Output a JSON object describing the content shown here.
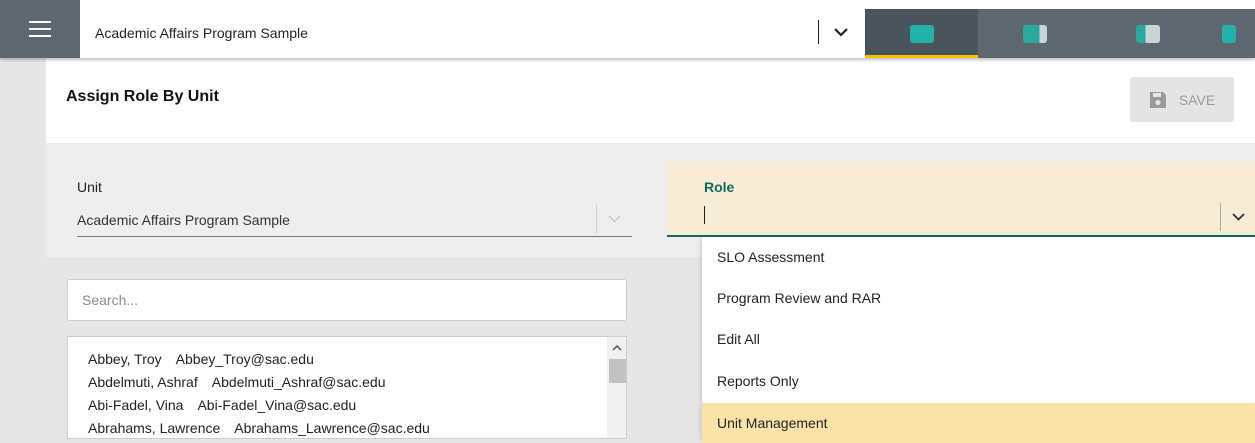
{
  "topbar": {
    "program_name": "Academic Affairs Program Sample",
    "tabs": [
      {
        "name": "tab-1",
        "active": true
      },
      {
        "name": "tab-2",
        "active": false
      },
      {
        "name": "tab-3",
        "active": false
      },
      {
        "name": "tab-4",
        "active": false
      }
    ]
  },
  "header": {
    "title": "Assign Role By Unit",
    "save_label": "SAVE"
  },
  "form": {
    "unit_label": "Unit",
    "unit_value": "Academic Affairs Program Sample",
    "role_label": "Role",
    "role_value": ""
  },
  "search": {
    "placeholder": "Search..."
  },
  "users": [
    {
      "name": "Abbey, Troy",
      "email": "Abbey_Troy@sac.edu"
    },
    {
      "name": "Abdelmuti, Ashraf",
      "email": "Abdelmuti_Ashraf@sac.edu"
    },
    {
      "name": "Abi-Fadel, Vina",
      "email": "Abi-Fadel_Vina@sac.edu"
    },
    {
      "name": "Abrahams, Lawrence",
      "email": "Abrahams_Lawrence@sac.edu"
    }
  ],
  "role_options": [
    {
      "label": "SLO Assessment",
      "selected": false
    },
    {
      "label": "Program Review and RAR",
      "selected": false
    },
    {
      "label": "Edit All",
      "selected": false
    },
    {
      "label": "Reports Only",
      "selected": false
    },
    {
      "label": "Unit Management",
      "selected": true
    }
  ],
  "colors": {
    "accent_teal": "#0f6b5f",
    "tab_active_underline": "#f2c300",
    "role_highlight": "#f9e3a6",
    "topbar_dark": "#5c6770"
  }
}
